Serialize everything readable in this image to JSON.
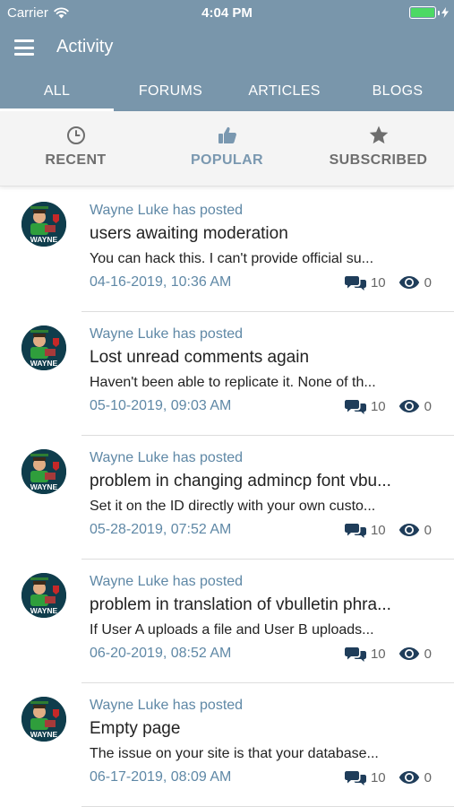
{
  "status_bar": {
    "carrier": "Carrier",
    "time": "4:04 PM"
  },
  "header": {
    "title": "Activity"
  },
  "top_tabs": [
    "ALL",
    "FORUMS",
    "ARTICLES",
    "BLOGS"
  ],
  "sub_tabs": [
    {
      "label": "RECENT",
      "icon": "clock-icon"
    },
    {
      "label": "POPULAR",
      "icon": "thumbs-up-icon"
    },
    {
      "label": "SUBSCRIBED",
      "icon": "star-icon"
    }
  ],
  "colors": {
    "header_bg": "#7996ab",
    "accent": "#7a98b0",
    "link": "#5f88a6",
    "battery": "#4cd964"
  },
  "avatar_text": "WAYNE",
  "feed": [
    {
      "poster": "Wayne Luke has posted",
      "title": "users awaiting moderation",
      "excerpt": "You can hack this. I can't provide official su...",
      "date": "04-16-2019, 10:36 AM",
      "replies": "10",
      "views": "0"
    },
    {
      "poster": "Wayne Luke has posted",
      "title": "Lost unread comments again",
      "excerpt": "Haven't been able to replicate it. None of th...",
      "date": "05-10-2019, 09:03 AM",
      "replies": "10",
      "views": "0"
    },
    {
      "poster": "Wayne Luke has posted",
      "title": "problem in changing admincp font vbu...",
      "excerpt": "Set it on the ID directly with your own custo...",
      "date": "05-28-2019, 07:52 AM",
      "replies": "10",
      "views": "0"
    },
    {
      "poster": "Wayne Luke has posted",
      "title": "problem in translation of vbulletin phra...",
      "excerpt": "If User A uploads a file and User B uploads...",
      "date": "06-20-2019, 08:52 AM",
      "replies": "10",
      "views": "0"
    },
    {
      "poster": "Wayne Luke has posted",
      "title": "Empty page",
      "excerpt": "The issue on your site is that your database...",
      "date": "06-17-2019, 08:09 AM",
      "replies": "10",
      "views": "0"
    }
  ]
}
